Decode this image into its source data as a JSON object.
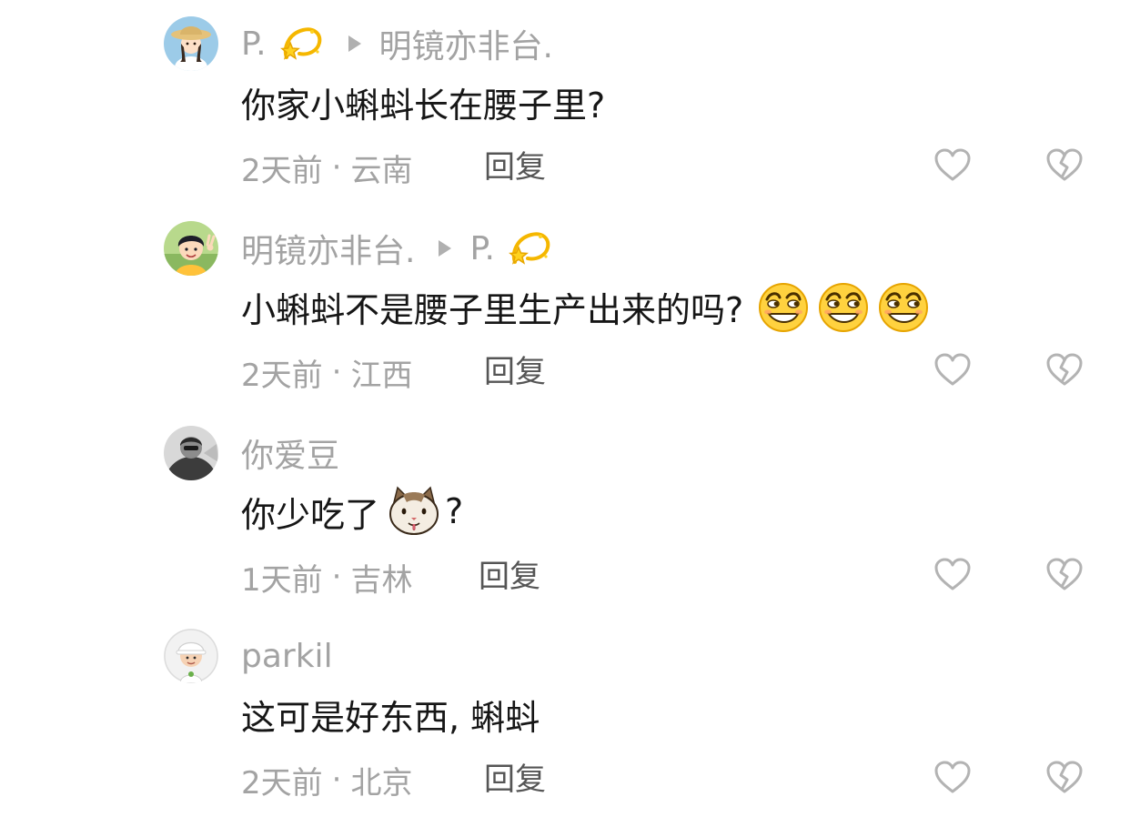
{
  "comments": [
    {
      "username": "P.",
      "username_emoji": "dizzy-star-emoji",
      "reply_to": "明镜亦非台.",
      "text": "你家小蝌蚪长在腰子里?",
      "time": "2天前",
      "location": "云南",
      "reply_label": "回复",
      "avatar": "girl-straw-hat-avatar"
    },
    {
      "username": "明镜亦非台.",
      "reply_to": "P.",
      "reply_to_emoji": "dizzy-star-emoji",
      "text": "小蝌蚪不是腰子里生产出来的吗?",
      "inline_emojis": [
        "smirk-emoji",
        "smirk-emoji",
        "smirk-emoji"
      ],
      "time": "2天前",
      "location": "江西",
      "reply_label": "回复",
      "avatar": "boy-peace-sign-avatar"
    },
    {
      "username": "你爱豆",
      "text_before": "你少吃了",
      "text_after": "?",
      "inline_emojis": [
        "cat-face-emoji"
      ],
      "time": "1天前",
      "location": "吉林",
      "reply_label": "回复",
      "avatar": "grayscale-photo-avatar"
    },
    {
      "username": "parkil",
      "text": "这可是好东西, 蝌蚪",
      "time": "2天前",
      "location": "北京",
      "reply_label": "回复",
      "avatar": "cartoon-boy-white-cap-avatar"
    }
  ],
  "meta_separator": "·",
  "icons": {
    "like": "heart-outline-icon",
    "dislike": "broken-heart-icon",
    "reply_arrow": "play-triangle-icon"
  },
  "colors": {
    "username": "#a3a3a3",
    "text": "#161616",
    "meta": "#a3a3a3",
    "reply": "#555555",
    "icon": "#b3b3b3"
  }
}
